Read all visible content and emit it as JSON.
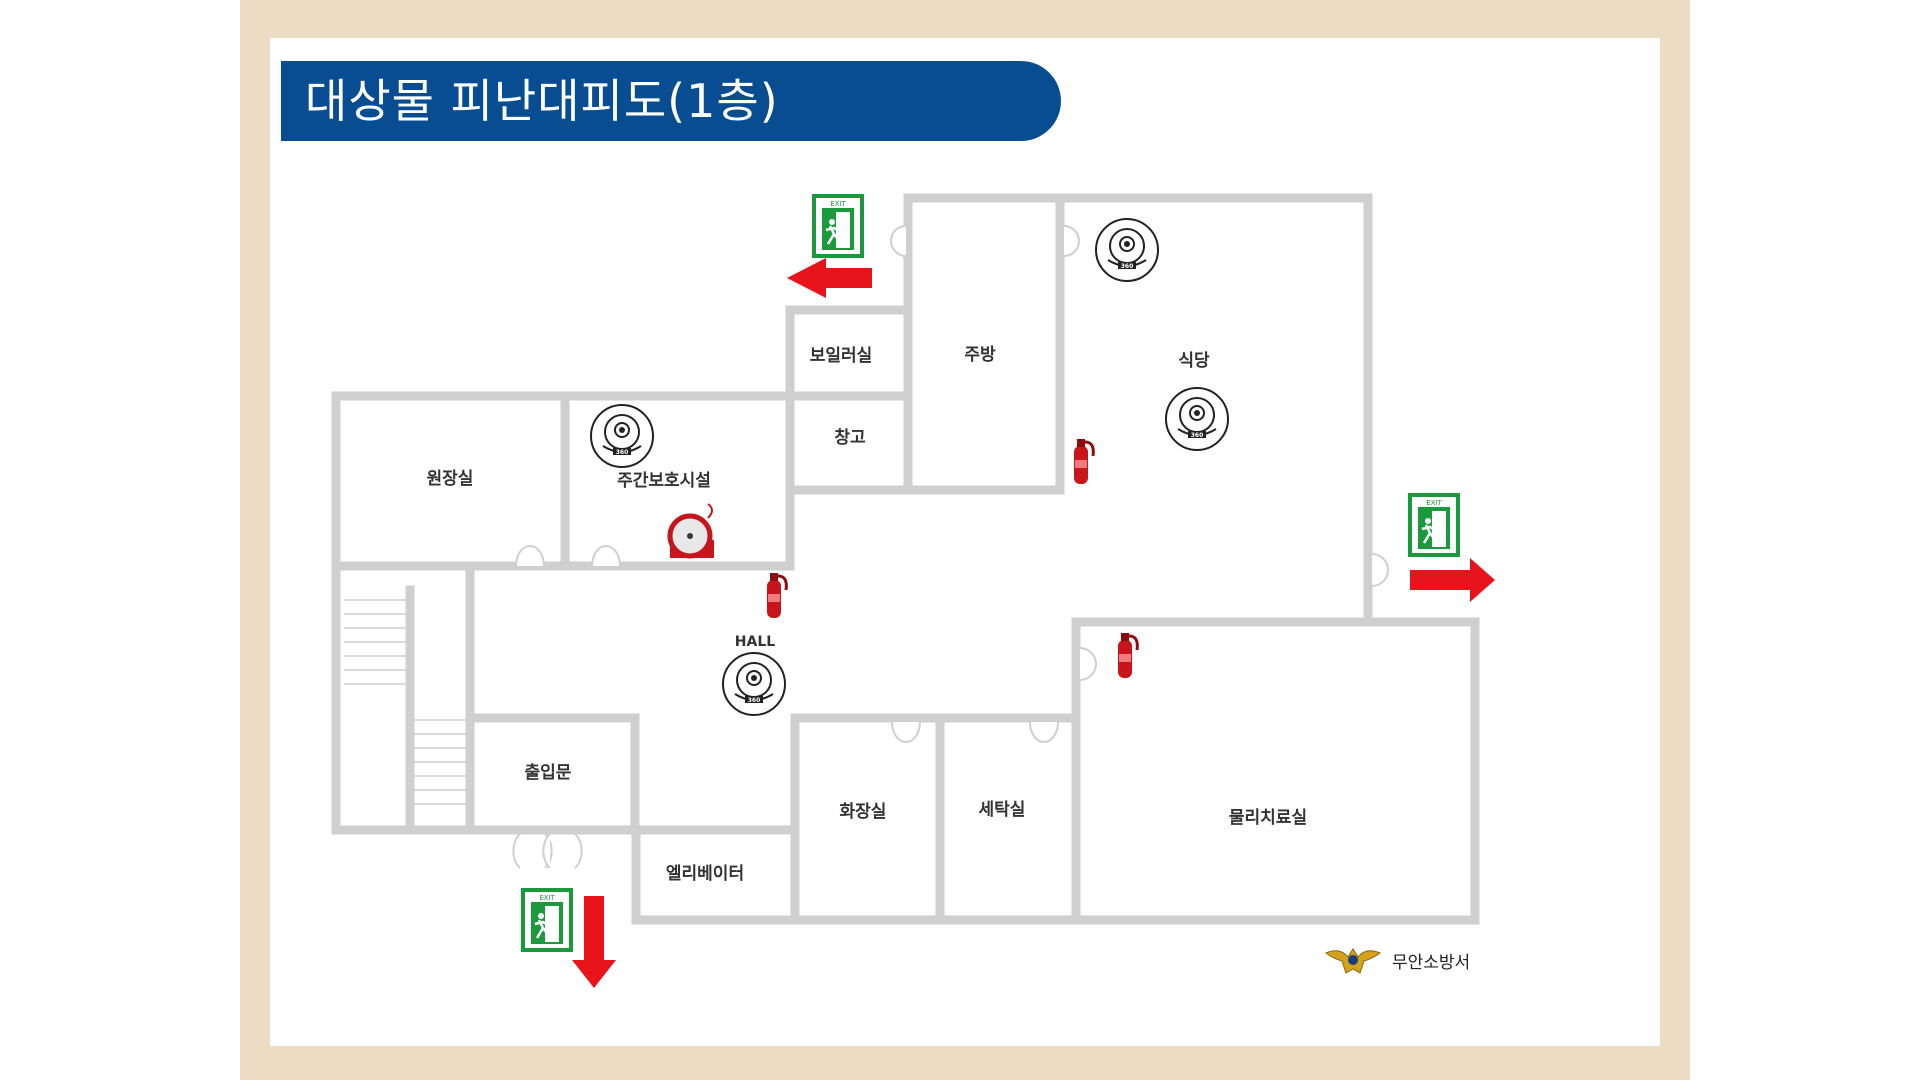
{
  "title": "대상물 피난대피도(1층)",
  "rooms": {
    "boiler": "보일러실",
    "kitchen": "주방",
    "dining": "식당",
    "storage": "창고",
    "director": "원장실",
    "daycare": "주간보호시설",
    "hall": "HALL",
    "entrance": "출입문",
    "restroom": "화장실",
    "laundry": "세탁실",
    "physio": "물리치료실",
    "elevator": "엘리베이터"
  },
  "exit_sign_text": "EXIT",
  "brand": {
    "name": "무안소방서",
    "emblem": "fire-department-emblem-icon"
  },
  "colors": {
    "title_bg": "#084c92",
    "frame": "#ecdcc4",
    "wall": "#cfcfcf",
    "exit_green": "#1a9a3c",
    "arrow_red": "#e8141b",
    "extinguisher_red": "#c8141b"
  },
  "icons": [
    "exit-sign-icon",
    "red-arrow-icon",
    "fire-extinguisher-icon",
    "360-camera-icon",
    "fire-alarm-bell-icon",
    "door-swing-icon"
  ]
}
